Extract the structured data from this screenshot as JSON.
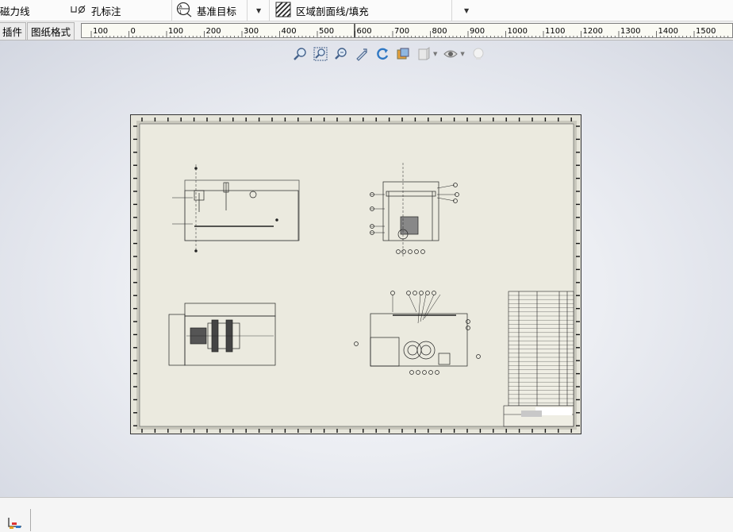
{
  "toolbar": {
    "items": [
      {
        "label": "磁力线",
        "icon": "magnet-line-icon"
      },
      {
        "label": "孔标注",
        "icon": "hole-callout-icon"
      },
      {
        "label": "基准目标",
        "icon": "datum-target-icon"
      },
      {
        "label": "区域剖面线/填充",
        "icon": "area-hatch-icon"
      }
    ]
  },
  "tabs": [
    {
      "label": "插件"
    },
    {
      "label": "图纸格式"
    }
  ],
  "ruler": {
    "labels": [
      "100",
      "0",
      "100",
      "200",
      "300",
      "400",
      "500",
      "600",
      "700",
      "800",
      "900",
      "1000",
      "1100",
      "1200",
      "1300",
      "1400",
      "1500"
    ]
  },
  "heads_up_toolbar": {
    "tools": [
      "zoom-to-fit-icon",
      "zoom-to-area-icon",
      "zoom-in-out-icon",
      "previous-view-icon",
      "rotate-view-icon",
      "display-style-icon",
      "section-view-icon",
      "hide-show-items-icon",
      "scene-icon"
    ]
  },
  "colors": {
    "sheet": "#e6e5da",
    "border": "#333333",
    "background": "#e4e7ee"
  },
  "status": {
    "icon": "coordinate-system-icon"
  }
}
